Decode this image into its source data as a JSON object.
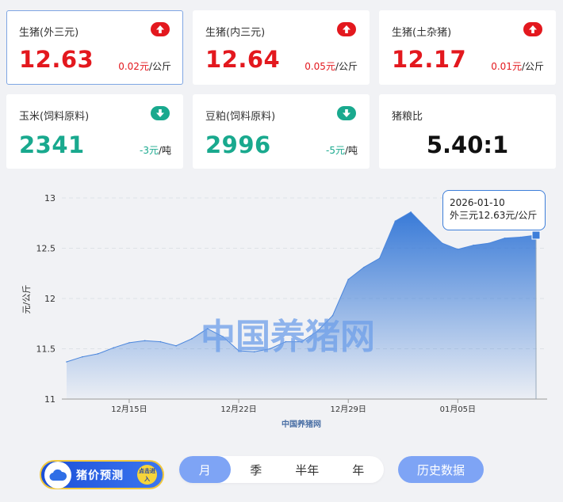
{
  "cards": [
    {
      "name": "生猪(外三元)",
      "value": "12.63",
      "change": "0.02元",
      "unit": "/公斤",
      "trend": "up"
    },
    {
      "name": "生猪(内三元)",
      "value": "12.64",
      "change": "0.05元",
      "unit": "/公斤",
      "trend": "up"
    },
    {
      "name": "生猪(土杂猪)",
      "value": "12.17",
      "change": "0.01元",
      "unit": "/公斤",
      "trend": "up"
    },
    {
      "name": "玉米(饲料原料)",
      "value": "2341",
      "change": "-3元",
      "unit": "/吨",
      "trend": "down"
    },
    {
      "name": "豆粕(饲料原料)",
      "value": "2996",
      "change": "-5元",
      "unit": "/吨",
      "trend": "down"
    }
  ],
  "ratio": {
    "name": "猪粮比",
    "value": "5.40:1"
  },
  "colors": {
    "up": "#e3181e",
    "down": "#19a98e",
    "accent": "#3d7ed9",
    "tab_active": "#7ea4f5"
  },
  "tooltip": {
    "date": "2026-01-10",
    "text": "外三元12.63元/公斤"
  },
  "watermark": "中国养猪网",
  "forecast": {
    "label": "猪价预测",
    "tap": "点击进入"
  },
  "tabs": [
    "月",
    "季",
    "半年",
    "年"
  ],
  "active_tab": "月",
  "history_label": "历史数据",
  "chart_data": {
    "type": "area",
    "title": "",
    "xlabel": "中国养猪网",
    "ylabel": "元/公斤",
    "ylim": [
      11,
      13
    ],
    "yticks": [
      11,
      11.5,
      12,
      12.5,
      13
    ],
    "x": [
      "12-11",
      "12-12",
      "12-13",
      "12-14",
      "12-15",
      "12-16",
      "12-17",
      "12-18",
      "12-19",
      "12-20",
      "12-21",
      "12-22",
      "12-23",
      "12-24",
      "12-25",
      "12-26",
      "12-27",
      "12-28",
      "12-29",
      "12-30",
      "12-31",
      "01-01",
      "01-02",
      "01-03",
      "01-04",
      "01-05",
      "01-06",
      "01-07",
      "01-08",
      "01-09",
      "01-10"
    ],
    "xtick_labels": [
      {
        "at": "12-15",
        "label": "12月15日"
      },
      {
        "at": "12-22",
        "label": "12月22日"
      },
      {
        "at": "12-29",
        "label": "12月29日"
      },
      {
        "at": "01-05",
        "label": "01月05日"
      }
    ],
    "series": [
      {
        "values": [
          11.37,
          11.42,
          11.45,
          11.51,
          11.56,
          11.58,
          11.57,
          11.53,
          11.6,
          11.7,
          11.62,
          11.48,
          11.47,
          11.5,
          11.57,
          11.57,
          11.67,
          11.83,
          12.19,
          12.31,
          12.4,
          12.77,
          12.86,
          12.7,
          12.55,
          12.49,
          12.53,
          12.55,
          12.6,
          12.61,
          12.63
        ]
      }
    ],
    "grid": true,
    "highlight_index": 30
  }
}
